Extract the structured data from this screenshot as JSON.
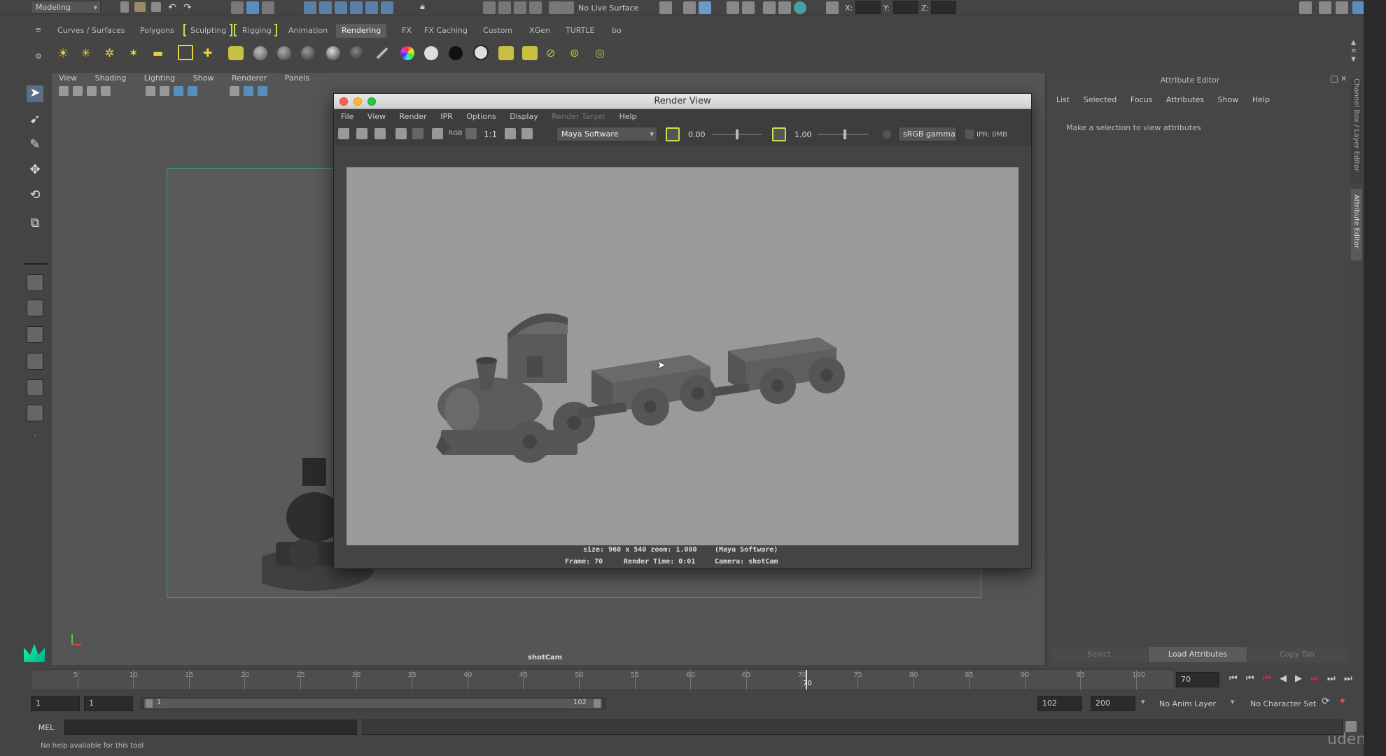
{
  "top": {
    "mode": "Modeling",
    "live_surface": "No Live Surface",
    "x_label": "X:",
    "y_label": "Y:",
    "z_label": "Z:"
  },
  "shelf_tabs": [
    {
      "label": "Curves / Surfaces"
    },
    {
      "label": "Polygons"
    },
    {
      "label": "Sculpting"
    },
    {
      "label": "Rigging"
    },
    {
      "label": "Animation"
    },
    {
      "label": "Rendering"
    },
    {
      "label": "FX"
    },
    {
      "label": "FX Caching"
    },
    {
      "label": "Custom"
    },
    {
      "label": "XGen"
    },
    {
      "label": "TURTLE"
    },
    {
      "label": "bo"
    }
  ],
  "panel_menu": [
    {
      "label": "View"
    },
    {
      "label": "Shading"
    },
    {
      "label": "Lighting"
    },
    {
      "label": "Show"
    },
    {
      "label": "Renderer"
    },
    {
      "label": "Panels"
    }
  ],
  "viewport": {
    "camera": "shotCam"
  },
  "render_view": {
    "title": "Render View",
    "menu": [
      {
        "label": "File"
      },
      {
        "label": "View"
      },
      {
        "label": "Render"
      },
      {
        "label": "IPR"
      },
      {
        "label": "Options"
      },
      {
        "label": "Display"
      },
      {
        "label": "Render Target"
      },
      {
        "label": "Help"
      }
    ],
    "ratio": "1:1",
    "rgb": "RGB",
    "renderer": "Maya Software",
    "exposure": "0.00",
    "gamma": "1.00",
    "colorspace": "sRGB gamma",
    "ipr": "IPR: 0MB",
    "info_size": "size: 960 x 540  zoom: 1.000",
    "info_renderer": "(Maya Software)",
    "info_frame": "Frame: 70",
    "info_time": "Render Time: 0:01",
    "info_camera": "Camera: shotCam"
  },
  "attribute_editor": {
    "title": "Attribute Editor",
    "menu": [
      {
        "label": "List"
      },
      {
        "label": "Selected"
      },
      {
        "label": "Focus"
      },
      {
        "label": "Attributes"
      },
      {
        "label": "Show"
      },
      {
        "label": "Help"
      }
    ],
    "message": "Make a selection to view attributes",
    "btn_select": "Select",
    "btn_load": "Load Attributes",
    "btn_copy": "Copy Tab",
    "side_tab_top": "Channel Box / Layer Editor",
    "side_tab": "Attribute Editor"
  },
  "timeline": {
    "ticks": [
      "5",
      "10",
      "15",
      "20",
      "25",
      "30",
      "35",
      "40",
      "45",
      "50",
      "55",
      "60",
      "65",
      "70",
      "75",
      "80",
      "85",
      "90",
      "95",
      "100"
    ],
    "current_label": "70",
    "current_field": "70"
  },
  "range": {
    "start": "1",
    "anim_start": "1",
    "slider_start": "1",
    "slider_end": "102",
    "end": "102",
    "anim_end": "200",
    "anim_layer": "No Anim Layer",
    "char_set": "No Character Set"
  },
  "command": {
    "lang": "MEL",
    "help": "No help available for this tool"
  },
  "watermark": "udemy",
  "colors": {
    "accent": "#5a8dbf",
    "tab_active": "#5d5d5d",
    "bracket": "#c8e050",
    "viewport": "#555555",
    "render_bg": "#9a9a9a"
  }
}
